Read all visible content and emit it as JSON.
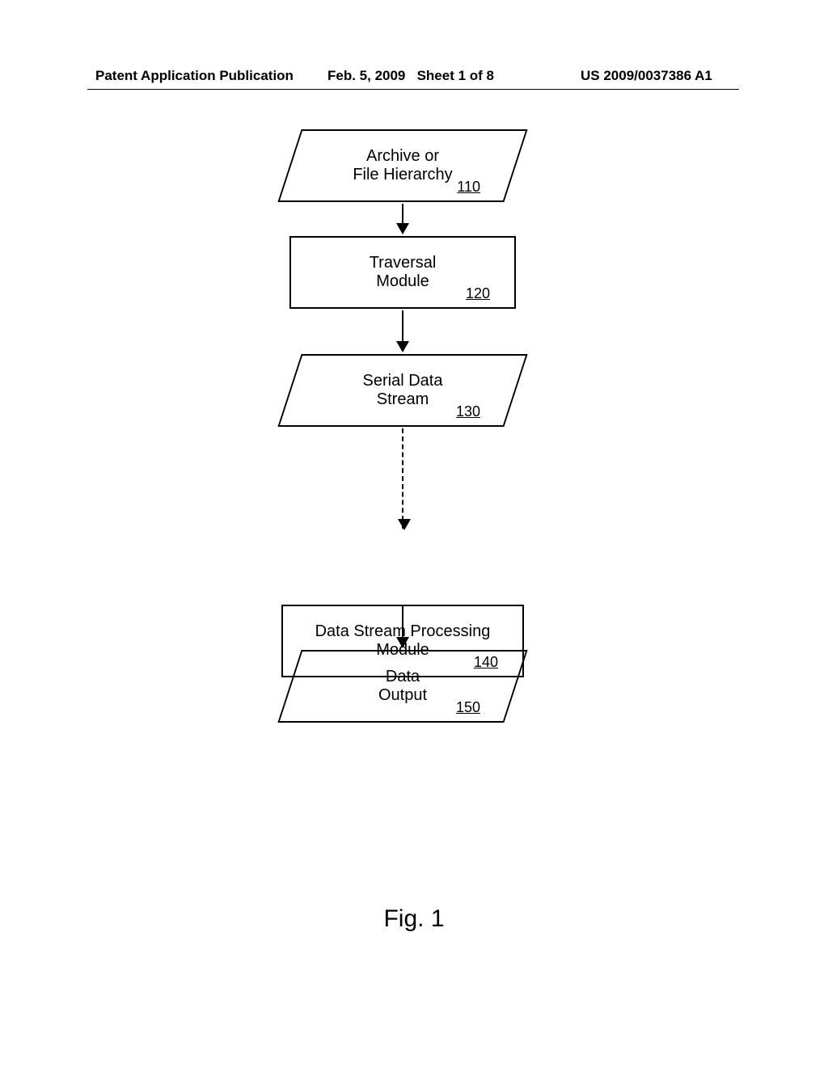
{
  "header": {
    "left": "Patent Application Publication",
    "mid_date": "Feb. 5, 2009",
    "mid_sheet": "Sheet 1 of 8",
    "right": "US 2009/0037386 A1"
  },
  "blocks": {
    "b110": {
      "line1": "Archive or",
      "line2": "File Hierarchy",
      "ref": "110"
    },
    "b120": {
      "line1": "Traversal",
      "line2": "Module",
      "ref": "120"
    },
    "b130": {
      "line1": "Serial Data",
      "line2": "Stream",
      "ref": "130"
    },
    "b140": {
      "line1": "Data Stream Processing",
      "line2": "Module",
      "ref": "140"
    },
    "b150": {
      "line1": "Data",
      "line2": "Output",
      "ref": "150"
    }
  },
  "figure_caption": "Fig. 1",
  "chart_data": {
    "type": "flowchart",
    "title": "Fig. 1",
    "nodes": [
      {
        "id": "110",
        "shape": "parallelogram",
        "label": "Archive or File Hierarchy"
      },
      {
        "id": "120",
        "shape": "rectangle",
        "label": "Traversal Module"
      },
      {
        "id": "130",
        "shape": "parallelogram",
        "label": "Serial Data Stream"
      },
      {
        "id": "140",
        "shape": "rectangle",
        "label": "Data Stream Processing Module"
      },
      {
        "id": "150",
        "shape": "parallelogram",
        "label": "Data Output"
      }
    ],
    "edges": [
      {
        "from": "110",
        "to": "120",
        "style": "solid"
      },
      {
        "from": "120",
        "to": "130",
        "style": "solid"
      },
      {
        "from": "130",
        "to": "140",
        "style": "dashed"
      },
      {
        "from": "140",
        "to": "150",
        "style": "solid"
      }
    ]
  }
}
